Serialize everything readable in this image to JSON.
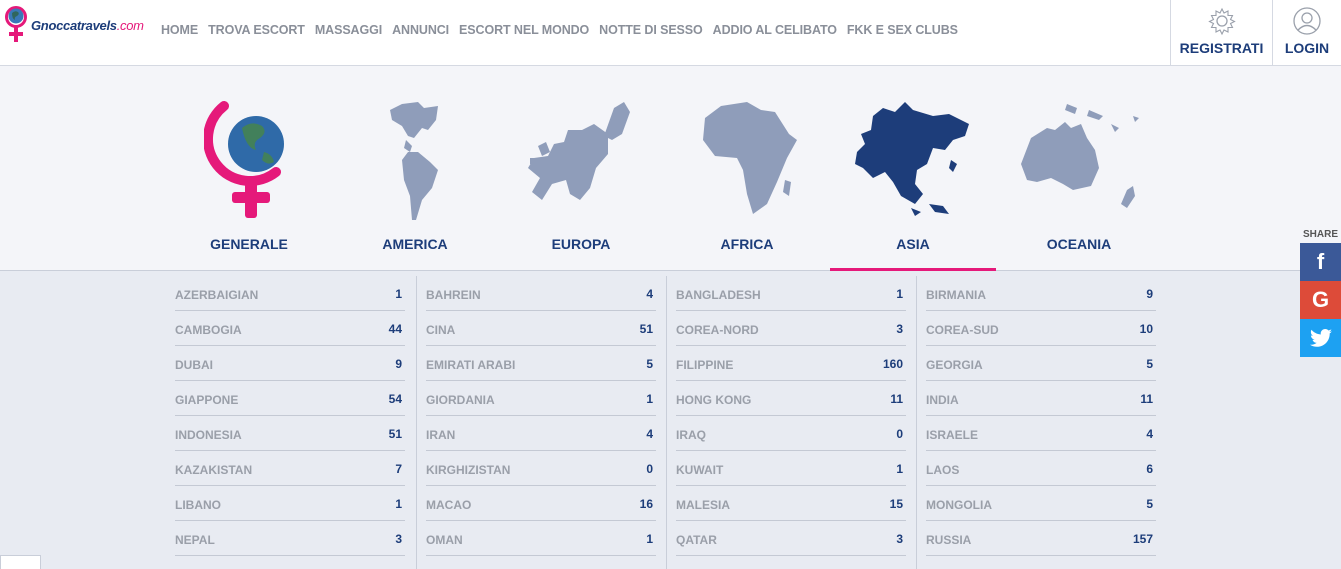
{
  "brand": {
    "name": "Gnoccatravels",
    "domain": ".com"
  },
  "nav": [
    "HOME",
    "TROVA ESCORT",
    "MASSAGGI",
    "ANNUNCI",
    "ESCORT NEL MONDO",
    "NOTTE DI SESSO",
    "ADDIO AL CELIBATO",
    "FKK E SEX CLUBS"
  ],
  "account": {
    "register": "REGISTRATI",
    "login": "LOGIN"
  },
  "continents": [
    {
      "label": "GENERALE",
      "active": false
    },
    {
      "label": "AMERICA",
      "active": false
    },
    {
      "label": "EUROPA",
      "active": false
    },
    {
      "label": "AFRICA",
      "active": false
    },
    {
      "label": "ASIA",
      "active": true
    },
    {
      "label": "OCEANIA",
      "active": false
    }
  ],
  "share": {
    "label": "SHARE",
    "facebook": "f",
    "google": "G",
    "twitter": "twitter-icon"
  },
  "colors": {
    "brand_blue": "#1d3d7a",
    "accent_pink": "#e5197a",
    "map_inactive": "#8f9dba",
    "map_active": "#1d3d7a"
  },
  "countries": [
    [
      {
        "name": "AZERBAIGIAN",
        "count": "1"
      },
      {
        "name": "CAMBOGIA",
        "count": "44"
      },
      {
        "name": "DUBAI",
        "count": "9"
      },
      {
        "name": "GIAPPONE",
        "count": "54"
      },
      {
        "name": "INDONESIA",
        "count": "51"
      },
      {
        "name": "KAZAKISTAN",
        "count": "7"
      },
      {
        "name": "LIBANO",
        "count": "1"
      },
      {
        "name": "NEPAL",
        "count": "3"
      }
    ],
    [
      {
        "name": "BAHREIN",
        "count": "4"
      },
      {
        "name": "CINA",
        "count": "51"
      },
      {
        "name": "EMIRATI ARABI",
        "count": "5"
      },
      {
        "name": "GIORDANIA",
        "count": "1"
      },
      {
        "name": "IRAN",
        "count": "4"
      },
      {
        "name": "KIRGHIZISTAN",
        "count": "0"
      },
      {
        "name": "MACAO",
        "count": "16"
      },
      {
        "name": "OMAN",
        "count": "1"
      }
    ],
    [
      {
        "name": "BANGLADESH",
        "count": "1"
      },
      {
        "name": "COREA-NORD",
        "count": "3"
      },
      {
        "name": "FILIPPINE",
        "count": "160"
      },
      {
        "name": "HONG KONG",
        "count": "11"
      },
      {
        "name": "IRAQ",
        "count": "0"
      },
      {
        "name": "KUWAIT",
        "count": "1"
      },
      {
        "name": "MALESIA",
        "count": "15"
      },
      {
        "name": "QATAR",
        "count": "3"
      }
    ],
    [
      {
        "name": "BIRMANIA",
        "count": "9"
      },
      {
        "name": "COREA-SUD",
        "count": "10"
      },
      {
        "name": "GEORGIA",
        "count": "5"
      },
      {
        "name": "INDIA",
        "count": "11"
      },
      {
        "name": "ISRAELE",
        "count": "4"
      },
      {
        "name": "LAOS",
        "count": "6"
      },
      {
        "name": "MONGOLIA",
        "count": "5"
      },
      {
        "name": "RUSSIA",
        "count": "157"
      }
    ]
  ]
}
